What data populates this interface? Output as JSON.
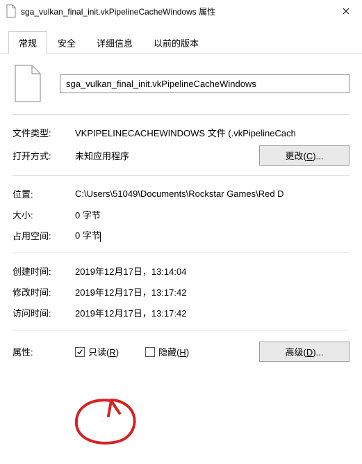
{
  "title": "sga_vulkan_final_init.vkPipelineCacheWindows 属性",
  "tabs": {
    "general": "常规",
    "security": "安全",
    "details": "详细信息",
    "previous": "以前的版本"
  },
  "filename": "sga_vulkan_final_init.vkPipelineCacheWindows",
  "rows": {
    "filetype_label": "文件类型:",
    "filetype_value": "VKPIPELINECACHEWINDOWS 文件 (.vkPipelineCach",
    "opens_label": "打开方式:",
    "opens_value": "未知应用程序",
    "change_btn_text": "更改(",
    "change_btn_key": "C",
    "change_btn_tail": ")...",
    "location_label": "位置:",
    "location_value": "C:\\Users\\51049\\Documents\\Rockstar Games\\Red D",
    "size_label": "大小:",
    "size_value": "0 字节",
    "sizeondisk_label": "占用空间:",
    "sizeondisk_value": "0 字节",
    "created_label": "创建时间:",
    "created_value": "2019年12月17日，13:14:04",
    "modified_label": "修改时间:",
    "modified_value": "2019年12月17日，13:17:42",
    "accessed_label": "访问时间:",
    "accessed_value": "2019年12月17日，13:17:42"
  },
  "attrs": {
    "label": "属性:",
    "readonly_text": "只读(",
    "readonly_key": "R",
    "readonly_tail": ")",
    "readonly_checked": true,
    "hidden_text": "隐藏(",
    "hidden_key": "H",
    "hidden_tail": ")",
    "hidden_checked": false,
    "advanced_text": "高级(",
    "advanced_key": "D",
    "advanced_tail": ")..."
  },
  "annotation_color": "#d82222"
}
